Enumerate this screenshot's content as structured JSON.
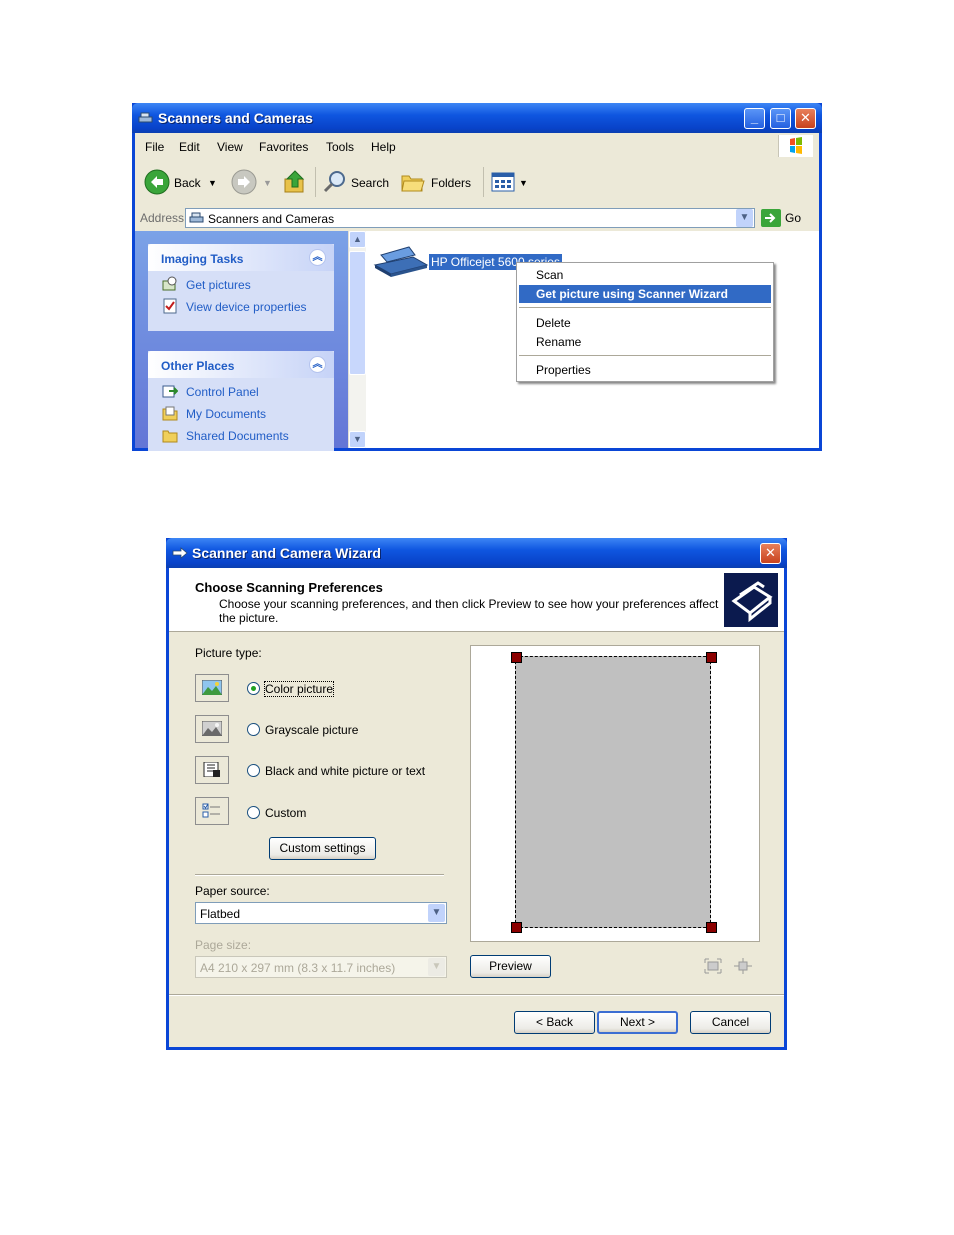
{
  "window1": {
    "title": "Scanners and Cameras",
    "menu": [
      "File",
      "Edit",
      "View",
      "Favorites",
      "Tools",
      "Help"
    ],
    "toolbar": {
      "back": "Back",
      "search": "Search",
      "folders": "Folders"
    },
    "address": {
      "label": "Address",
      "value": "Scanners and Cameras",
      "go": "Go"
    },
    "imaging_tasks": {
      "title": "Imaging Tasks",
      "links": [
        "Get pictures",
        "View device properties"
      ]
    },
    "other_places": {
      "title": "Other Places",
      "links": [
        "Control Panel",
        "My Documents",
        "Shared Documents"
      ]
    },
    "device": {
      "name": "HP Officejet 5600 series"
    },
    "context_menu": {
      "items": [
        "Scan",
        "Get picture using Scanner Wizard",
        "Delete",
        "Rename",
        "Properties"
      ],
      "selected": "Get picture using Scanner Wizard"
    }
  },
  "window2": {
    "title": "Scanner and Camera Wizard",
    "header_title": "Choose Scanning Preferences",
    "header_subtitle": "Choose your scanning preferences, and then click Preview to see how your preferences affect the picture.",
    "picture_type_label": "Picture type:",
    "options": [
      "Color picture",
      "Grayscale picture",
      "Black and white picture or text",
      "Custom"
    ],
    "selected_option": "Color picture",
    "custom_settings": "Custom settings",
    "paper_source_label": "Paper source:",
    "paper_source_value": "Flatbed",
    "page_size_label": "Page size:",
    "page_size_value": "A4 210 x 297 mm (8.3 x 11.7 inches)",
    "preview": "Preview",
    "back": "< Back",
    "next": "Next >",
    "cancel": "Cancel"
  }
}
